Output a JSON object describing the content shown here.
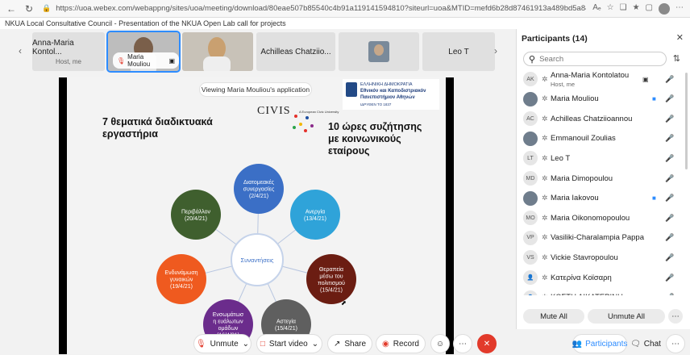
{
  "browser": {
    "url": "https://uoa.webex.com/webappng/sites/uoa/meeting/download/80eae507b85540c4b91a119141594810?siteurl=uoa&MTID=mefd6b28d87461913a489bd5a84c34bf0"
  },
  "window_title": "NKUA Local Consultative Council - Presentation of the NKUA Open Lab call for projects",
  "strip": {
    "tiles": [
      {
        "name": "Anna-Maria Kontol...",
        "sub": "Host, me"
      },
      {
        "name": "Maria Mouliou"
      },
      {
        "name": ""
      },
      {
        "name": "Achilleas Chatziio..."
      },
      {
        "name": ""
      },
      {
        "name": "Leo T"
      }
    ]
  },
  "slide": {
    "viewing": "Viewing Maria Mouliou's application",
    "civis": "CIVIS",
    "civis_sub": "A European Civic University",
    "uoa_lines": [
      "ΕΛΛΗΝΙΚΗ ΔΗΜΟΚΡΑΤΙΑ",
      "Εθνικόν και Καποδιστριακόν",
      "Πανεπιστήμιον Αθηνών",
      "ΙΔΡΥΘΕΝ ΤΟ 1837"
    ],
    "heading_left": "7 θεματικά διαδικτυακά εργαστήρια",
    "heading_right": "10 ώρες συζήτησης με κοινωνικούς εταίρους",
    "center": "Συναντήσεις",
    "nodes": [
      {
        "lines": [
          "Διατομεακές",
          "συνεργασίες",
          "(2/4/21)"
        ],
        "color": "#3b6fc6"
      },
      {
        "lines": [
          "Ανεργία",
          "(13/4/21)"
        ],
        "color": "#2fa3d9"
      },
      {
        "lines": [
          "Θεραπεία",
          "μέσω του",
          "πολιτισμού",
          "(15/4/21)"
        ],
        "color": "#6b1d12"
      },
      {
        "lines": [
          "Αστεγία",
          "(15/4/21)"
        ],
        "color": "#5f5f5f"
      },
      {
        "lines": [
          "Ενσωμάτωσ",
          "η ευάλωτων",
          "ομάδων",
          "(16/4/21)"
        ],
        "color": "#6b2c8c"
      },
      {
        "lines": [
          "Ενδυνάμωση",
          "γυναικών",
          "(19/4/21)"
        ],
        "color": "#ef5a1f"
      },
      {
        "lines": [
          "Περιβάλλον",
          "(20/4/21)"
        ],
        "color": "#3f5f2e"
      }
    ]
  },
  "toolbar": {
    "unmute": "Unmute",
    "start_video": "Start video",
    "share": "Share",
    "record": "Record",
    "participants": "Participants",
    "chat": "Chat"
  },
  "panel": {
    "title": "Participants (14)",
    "search_placeholder": "Search",
    "mute_all": "Mute All",
    "unmute_all": "Unmute All",
    "participants": [
      {
        "initials": "AK",
        "name": "Anna-Maria Kontolatou",
        "role": "Host, me",
        "share": true
      },
      {
        "initials": "",
        "name": "Maria Mouliou",
        "photo": true,
        "video": true,
        "unmuted": true
      },
      {
        "initials": "AC",
        "name": "Achilleas Chatziioannou"
      },
      {
        "initials": "",
        "name": "Emmanouil Zoulias",
        "photo": true
      },
      {
        "initials": "LT",
        "name": "Leo T"
      },
      {
        "initials": "MD",
        "name": "Maria Dimopoulou"
      },
      {
        "initials": "",
        "name": "Maria Iakovou",
        "photo": true,
        "video": true
      },
      {
        "initials": "MO",
        "name": "Maria Oikonomopoulou"
      },
      {
        "initials": "VP",
        "name": "Vasiliki-Charalampia Pappa"
      },
      {
        "initials": "VS",
        "name": "Vickie Stavropoulou"
      },
      {
        "initials": "",
        "name": "Κατερίνα Κοϊσαρη",
        "person": true
      },
      {
        "initials": "",
        "name": "ΚΩΣΤΗ ΑΙΚΑΤΕΡΙΝΗ",
        "person": true
      }
    ]
  }
}
